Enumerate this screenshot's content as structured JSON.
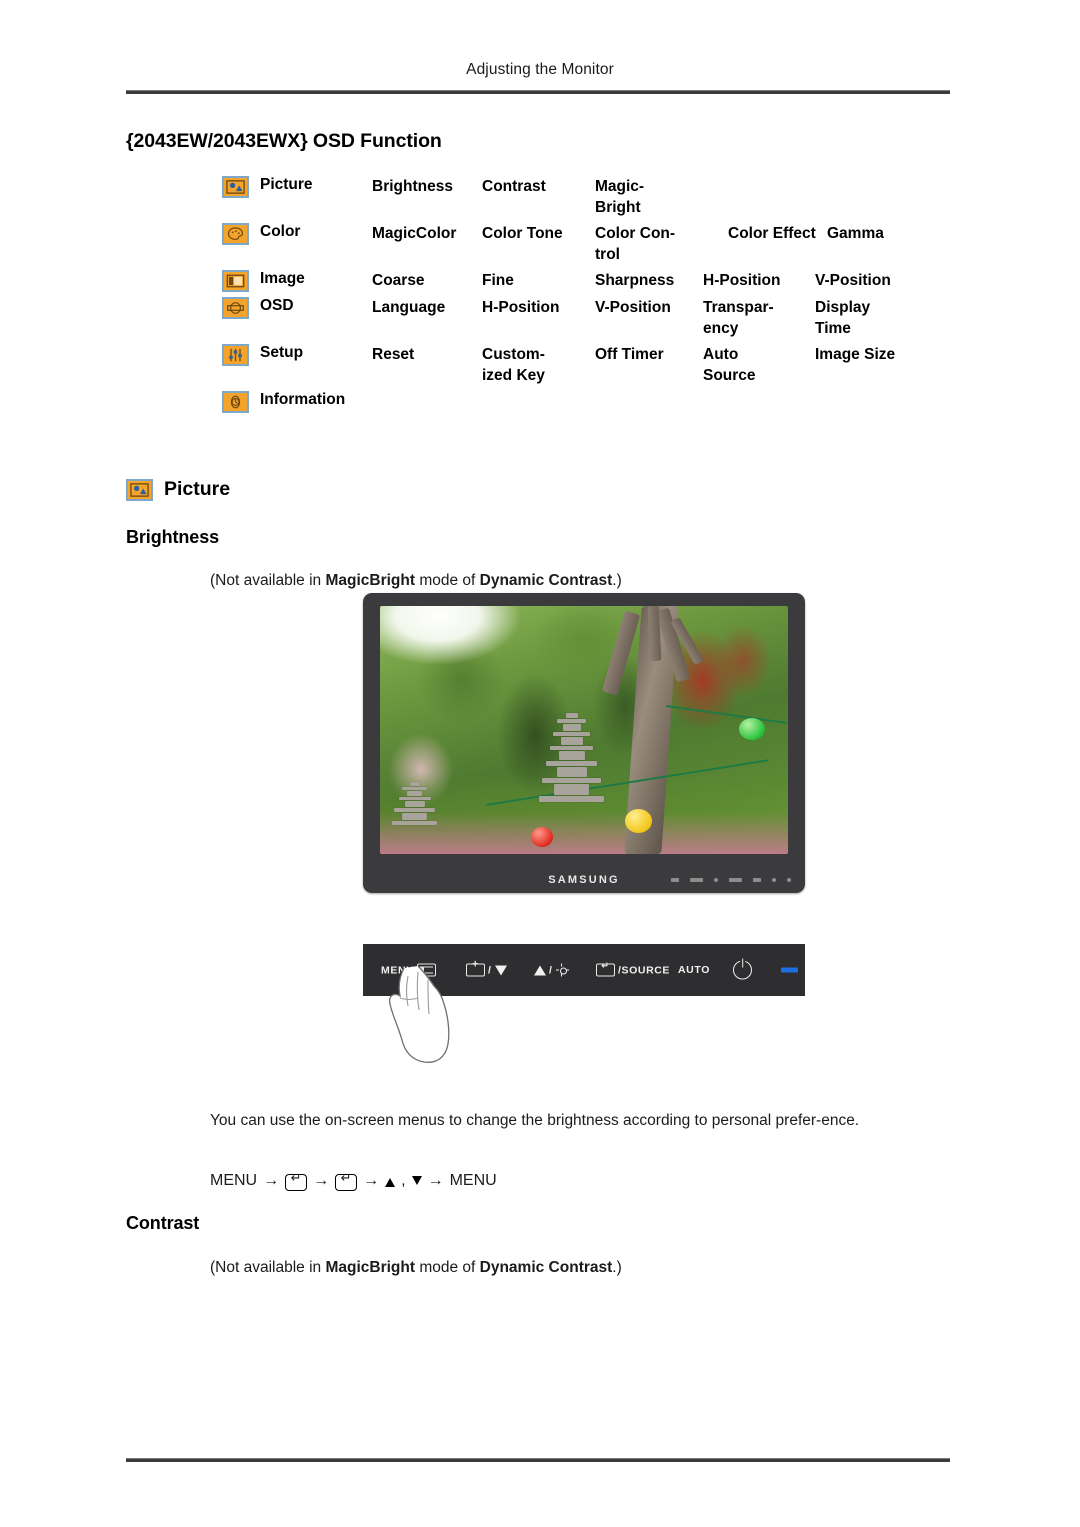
{
  "header": {
    "running_head": "Adjusting the Monitor"
  },
  "title": {
    "osd_function": "{2043EW/2043EWX} OSD Function"
  },
  "osd_table": {
    "rows": [
      {
        "icon": "picture-icon",
        "category": "Picture",
        "cells": [
          "Brightness",
          "Contrast",
          "Magic-\nBright",
          "",
          ""
        ]
      },
      {
        "icon": "color-icon",
        "category": "Color",
        "cells": [
          "MagicColor",
          "Color Tone",
          "Color  Con-\ntrol",
          "Color Effect",
          "Gamma"
        ]
      },
      {
        "icon": "image-icon",
        "category": "Image",
        "cells": [
          "Coarse",
          "Fine",
          "Sharpness",
          "H-Position",
          "V-Position"
        ]
      },
      {
        "icon": "osd-icon",
        "category": "OSD",
        "cells": [
          "Language",
          "H-Position",
          "V-Position",
          "Transpar-\nency",
          "Display\nTime"
        ]
      },
      {
        "icon": "setup-icon",
        "category": "Setup",
        "cells": [
          "Reset",
          "Custom-\nized Key",
          "Off Timer",
          "Auto\nSource",
          "Image Size"
        ]
      },
      {
        "icon": "information-icon",
        "category": "Information",
        "cells": [
          "",
          "",
          "",
          "",
          ""
        ]
      }
    ]
  },
  "picture_section": {
    "icon": "picture-icon",
    "heading": "Picture",
    "brightness": {
      "heading": "Brightness",
      "note_prefix": "(Not available in ",
      "note_bold1": "MagicBright",
      "note_middle": "  mode of ",
      "note_bold2": "Dynamic Contrast",
      "note_suffix": ".)",
      "description": "You can use the on-screen menus to change the brightness according to personal prefer-ence.",
      "menu_path": {
        "start": "MENU",
        "arrow": "→",
        "comma": ",",
        "end": "MENU"
      }
    },
    "contrast": {
      "heading": "Contrast",
      "note_prefix": "(Not available in ",
      "note_bold1": "MagicBright",
      "note_middle": " mode of ",
      "note_bold2": "Dynamic Contrast",
      "note_suffix": ".)"
    }
  },
  "monitor": {
    "brand_logo": "SAMSUNG",
    "control_bar": {
      "menu_label": "MENU",
      "down_label": "/",
      "up_label": "/",
      "source_label": "/SOURCE",
      "auto_label": "AUTO",
      "power_label": "",
      "led_label": ""
    }
  },
  "colors": {
    "icon_fill": "#f4a32b",
    "icon_border": "#7fa7c9",
    "bezel": "#3b3b3d",
    "control_bar": "#2e2e30",
    "led": "#1b6fe0",
    "rule": "#3a3a3a"
  }
}
